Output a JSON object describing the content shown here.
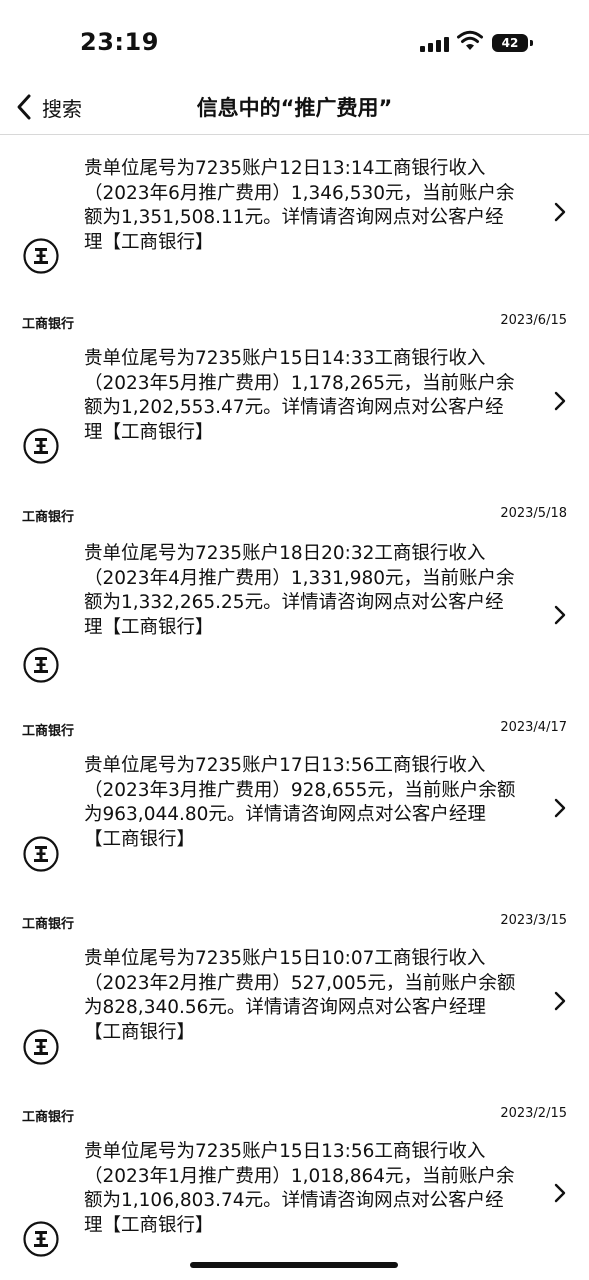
{
  "status_bar": {
    "time": "23:19",
    "battery": "42"
  },
  "nav": {
    "back_label": "搜索",
    "title": "信息中的“推广费用”"
  },
  "messages": [
    {
      "text": "贵单位尾号为7235账户12日13:14工商银行收入（2023年6月推广费用）1,346,530元，当前账户余额为1,351,508.11元。详情请咨询网点对公客户经理【工商银行】",
      "sender": "工商银行",
      "date": "2023/6/15"
    },
    {
      "text": "贵单位尾号为7235账户15日14:33工商银行收入（2023年5月推广费用）1,178,265元，当前账户余额为1,202,553.47元。详情请咨询网点对公客户经理【工商银行】",
      "sender": "工商银行",
      "date": "2023/5/18"
    },
    {
      "text": "贵单位尾号为7235账户18日20:32工商银行收入（2023年4月推广费用）1,331,980元，当前账户余额为1,332,265.25元。详情请咨询网点对公客户经理【工商银行】",
      "sender": "工商银行",
      "date": "2023/4/17"
    },
    {
      "text": "贵单位尾号为7235账户17日13:56工商银行收入（2023年3月推广费用）928,655元，当前账户余额为963,044.80元。详情请咨询网点对公客户经理【工商银行】",
      "sender": "工商银行",
      "date": "2023/3/15"
    },
    {
      "text": "贵单位尾号为7235账户15日10:07工商银行收入（2023年2月推广费用）527,005元，当前账户余额为828,340.56元。详情请咨询网点对公客户经理【工商银行】",
      "sender": "工商银行",
      "date": "2023/2/15"
    },
    {
      "text": "贵单位尾号为7235账户15日13:56工商银行收入（2023年1月推广费用）1,018,864元，当前账户余额为1,106,803.74元。详情请咨询网点对公客户经理【工商银行】"
    }
  ]
}
